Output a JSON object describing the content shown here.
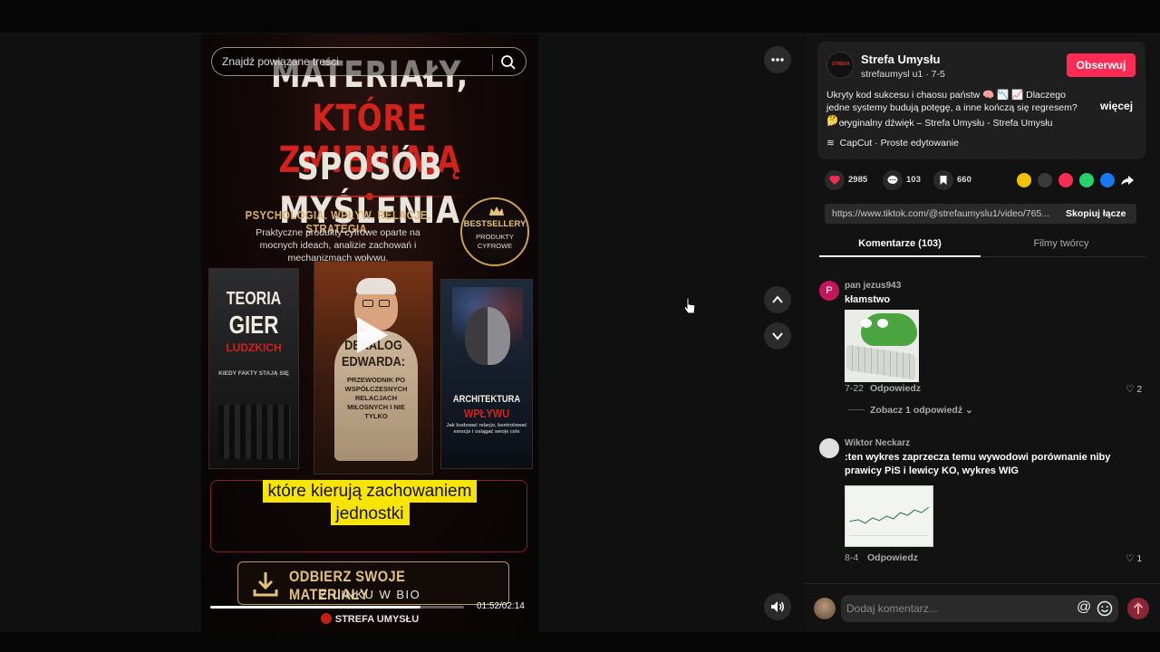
{
  "video": {
    "search_placeholder": "Znajdź powiązane treści",
    "poster": {
      "line1": "MATERIAŁY,",
      "line2": "KTÓRE ZMIENIAJĄ",
      "line3": "SPOSÓB MYŚLENIA",
      "tagline": "PSYCHOLOGIA. WPŁYW. RELACJE. STRATEGIA.",
      "subline": "Praktyczne produkty cyfrowe oparte na mocnych ideach, analizie zachowań i mechanizmach wpływu.",
      "badge_title": "BESTSELLERY",
      "badge_sub": "PRODUKTY CYFROWE"
    },
    "books": [
      {
        "title1": "TEORIA",
        "title2": "GIER",
        "title3": "LUDZKICH",
        "subtitle": "KIEDY FAKTY STAJĄ SIĘ"
      },
      {
        "title1": "DEKALOG",
        "title2": "EDWARDA:",
        "subtitle": "PRZEWODNIK PO WSPÓŁCZESNYCH RELACJACH MIŁOSNYCH I NIE TYLKO"
      },
      {
        "title1": "ARCHITEKTURA",
        "title2": "WPŁYWU",
        "subtitle": "Jak budować relacje, kontrolować emocje i osiągać swoje cele"
      }
    ],
    "caption_line1": "które kierują zachowaniem",
    "caption_line2": "jednostki",
    "cta_line1": "ODBIERZ SWOJE MATERIAŁY",
    "cta_line2": "Z LINKU W BIO",
    "progress": 0.83,
    "time": "01:52/02:14",
    "brand": "STREFA UMYSŁU"
  },
  "creator": {
    "name": "Strefa Umysłu",
    "handle": "strefaumysl u1 · 7-5",
    "follow_label": "Obserwuj",
    "description": "Ukryty kod sukcesu i chaosu państw 🧠 📉 📈 Dlaczego jedne systemy budują potęgę, a inne kończą się regresem? 🤔 ...",
    "more_label": "więcej",
    "music": "oryginalny dźwięk – Strefa Umysłu - Strefa Umysłu",
    "capcut": "CapCut · Proste edytowanie"
  },
  "stats": {
    "likes": "2985",
    "comments": "103",
    "saves": "660"
  },
  "link": {
    "url": "https://www.tiktok.com/@strefaumyslu1/video/765...",
    "copy_label": "Skopiuj łącze"
  },
  "tabs": {
    "comments": "Komentarze (103)",
    "creator_videos": "Filmy twórcy"
  },
  "comments": [
    {
      "user": "pan jezus943",
      "avatar_letter": "P",
      "text": "kłamstwo",
      "date": "7-22",
      "reply": "Odpowiedz",
      "likes": "2",
      "view_replies": "Zobacz 1 odpowiedź"
    },
    {
      "user": "Wiktor Neckarz",
      "text": ":ten wykres zaprzecza temu wywodowi porównanie niby prawicy PiS i lewicy KO, wykres WIG",
      "date": "8-4",
      "reply": "Odpowiedz",
      "likes": "1"
    }
  ],
  "comment_box": {
    "placeholder": "Dodaj komentarz...",
    "at_symbol": "@"
  },
  "colors": {
    "accent": "#fe2c55",
    "background": "#121212"
  }
}
